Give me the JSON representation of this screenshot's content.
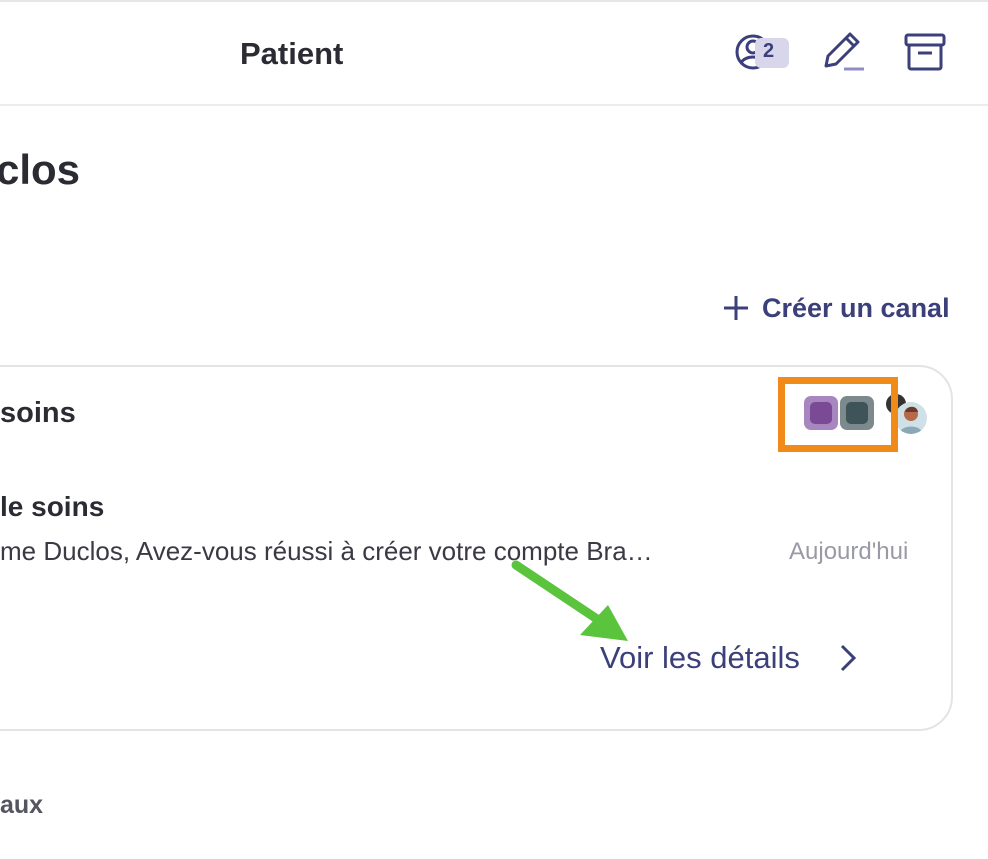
{
  "header": {
    "title": "Patient",
    "members_count": "2"
  },
  "page": {
    "title": "clos"
  },
  "actions": {
    "create_channel_label": "Créer un canal"
  },
  "card": {
    "title": "soins",
    "channel_name": "le soins",
    "last_message": "me Duclos, Avez-vous réussi à créer votre compte Bra…",
    "timestamp": "Aujourd'hui",
    "details_label": "Voir les détails"
  },
  "footer": {
    "section_label": "aux"
  },
  "colors": {
    "accent": "#3b3f7a",
    "highlight_box": "#f08a18",
    "annotation_arrow": "#5ac43c"
  }
}
